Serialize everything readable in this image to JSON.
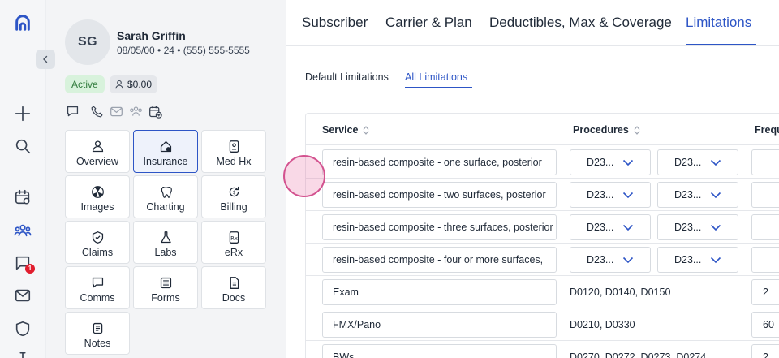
{
  "rail": {
    "icons": [
      "logo-icon",
      "add-icon",
      "search-icon",
      "schedule-icon",
      "patients-icon",
      "messages-icon",
      "mail-icon",
      "shield-icon",
      "more-icon"
    ],
    "messages_badge": "1"
  },
  "patient": {
    "initials": "SG",
    "name": "Sarah Griffin",
    "meta": "08/05/00 • 24 • (555) 555-5555",
    "status": "Active",
    "balance": "$0.00",
    "tiles": [
      {
        "label": "Overview",
        "icon": "overview-icon"
      },
      {
        "label": "Insurance",
        "icon": "insurance-icon",
        "active": true
      },
      {
        "label": "Med Hx",
        "icon": "med-hx-icon"
      },
      {
        "label": "Images",
        "icon": "images-icon"
      },
      {
        "label": "Charting",
        "icon": "tooth-icon"
      },
      {
        "label": "Billing",
        "icon": "billing-icon"
      },
      {
        "label": "Claims",
        "icon": "claims-icon"
      },
      {
        "label": "Labs",
        "icon": "labs-icon"
      },
      {
        "label": "eRx",
        "icon": "erx-icon"
      },
      {
        "label": "Comms",
        "icon": "comms-icon"
      },
      {
        "label": "Forms",
        "icon": "forms-icon"
      },
      {
        "label": "Docs",
        "icon": "docs-icon"
      },
      {
        "label": "Notes",
        "icon": "notes-icon"
      }
    ]
  },
  "tabs": [
    "Subscriber",
    "Carrier & Plan",
    "Deductibles, Max & Coverage",
    "Limitations"
  ],
  "active_tab": "Limitations",
  "subtabs": [
    "Default Limitations",
    "All Limitations"
  ],
  "active_subtab": "All Limitations",
  "table": {
    "headers": [
      "Service",
      "Procedures",
      "Frequ"
    ],
    "rows": [
      {
        "service": "resin-based composite - one surface, posterior",
        "proc1": "D23...",
        "proc2": "D23...",
        "freq": ""
      },
      {
        "service": "resin-based composite - two surfaces, posterior",
        "proc1": "D23...",
        "proc2": "D23...",
        "freq": ""
      },
      {
        "service": "resin-based composite - three surfaces, posterior",
        "proc1": "D23...",
        "proc2": "D23...",
        "freq": ""
      },
      {
        "service": "resin-based composite - four or more surfaces,",
        "proc1": "D23...",
        "proc2": "D23...",
        "freq": ""
      },
      {
        "service": "Exam",
        "codes": "D0120, D0140, D0150",
        "freq": "2"
      },
      {
        "service": "FMX/Pano",
        "codes": "D0210, D0330",
        "freq": "60"
      },
      {
        "service": "BWs",
        "codes": "D0270, D0272, D0273, D0274",
        "freq": "2"
      }
    ]
  },
  "colors": {
    "accent": "#2d55c6",
    "active_green": "#d8f2dc",
    "badge_red": "#e11d2e"
  }
}
